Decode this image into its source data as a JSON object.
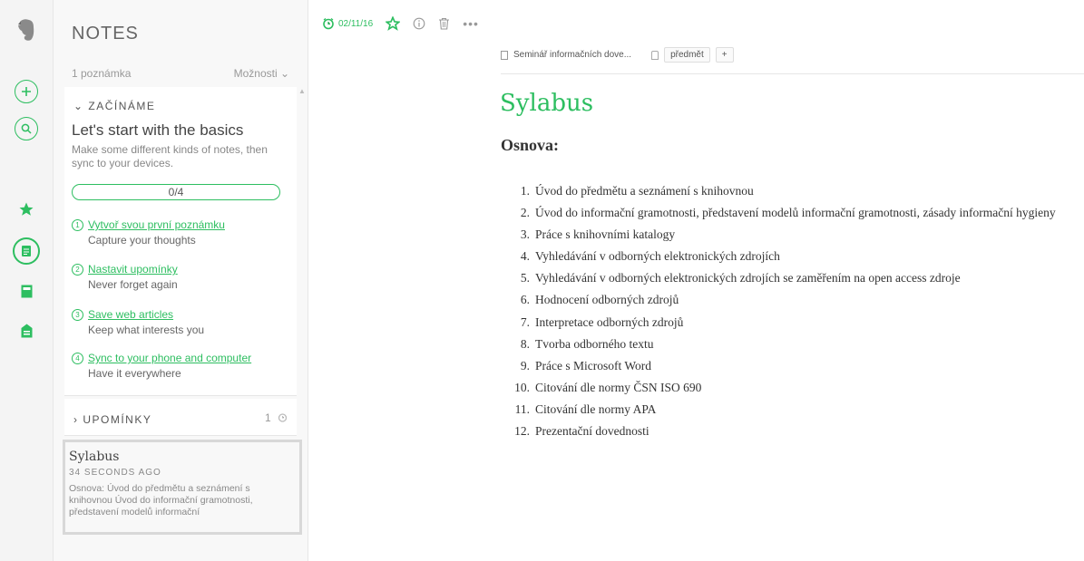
{
  "rail": {
    "icons": [
      "evernote-logo-icon",
      "new-note-icon",
      "search-icon",
      "shortcuts-star-icon",
      "notes-icon",
      "notebooks-icon",
      "tags-icon"
    ]
  },
  "notes": {
    "title": "NOTES",
    "count": "1 poznámka",
    "options": "Možnosti ⌄",
    "start": {
      "section": "⌄ ZAČÍNÁME",
      "title": "Let's start with the basics",
      "desc": "Make some different kinds of notes, then sync to your devices.",
      "progress_text": "0/4",
      "progress_fraction": 0,
      "steps": [
        {
          "num": "1",
          "link": "Vytvoř svou první poznámku",
          "sub": "Capture your thoughts"
        },
        {
          "num": "2",
          "link": "Nastavit upomínky",
          "sub": "Never forget again"
        },
        {
          "num": "3",
          "link": "Save web articles",
          "sub": "Keep what interests you"
        },
        {
          "num": "4",
          "link": "Sync to your phone and computer",
          "sub": "Have it everywhere"
        }
      ]
    },
    "reminders": {
      "section": "› UPOMÍNKY",
      "count": "1"
    },
    "card": {
      "title": "Sylabus",
      "time": "34 SECONDS AGO",
      "snippet": "Osnova:  Úvod do předmětu a seznámení s knihovnou Úvod do informační gramotnosti, představení modelů informační"
    }
  },
  "toolbar": {
    "date": "02/11/16",
    "more": "•••"
  },
  "meta": {
    "notebook": "Seminář informačních dove...",
    "tag": "předmět",
    "tag_add": "+"
  },
  "doc": {
    "title": "Sylabus",
    "heading": "Osnova:",
    "items": [
      {
        "n": "1.",
        "text": "Úvod do předmětu a seznámení s knihovnou"
      },
      {
        "n": "2.",
        "text": "Úvod do informační gramotnosti, představení modelů informační gramotnosti, zásady informační hygieny"
      },
      {
        "n": "3.",
        "text": "Práce s knihovními katalogy"
      },
      {
        "n": "4.",
        "text": "Vyhledávání v odborných elektronických zdrojích"
      },
      {
        "n": "5.",
        "text": "Vyhledávání v odborných elektronických zdrojích se zaměřením na open access zdroje"
      },
      {
        "n": "6.",
        "text": "Hodnocení odborných zdrojů"
      },
      {
        "n": "7.",
        "text": "Interpretace odborných zdrojů"
      },
      {
        "n": "8.",
        "text": "Tvorba odborného textu"
      },
      {
        "n": "9.",
        "text": "Práce s Microsoft Word"
      },
      {
        "n": "10.",
        "text": "Citování dle normy ČSN ISO 690"
      },
      {
        "n": "11.",
        "text": "Citování dle normy APA"
      },
      {
        "n": "12.",
        "text": "Prezentační dovednosti"
      }
    ]
  },
  "colors": {
    "accent": "#2dbe60"
  }
}
